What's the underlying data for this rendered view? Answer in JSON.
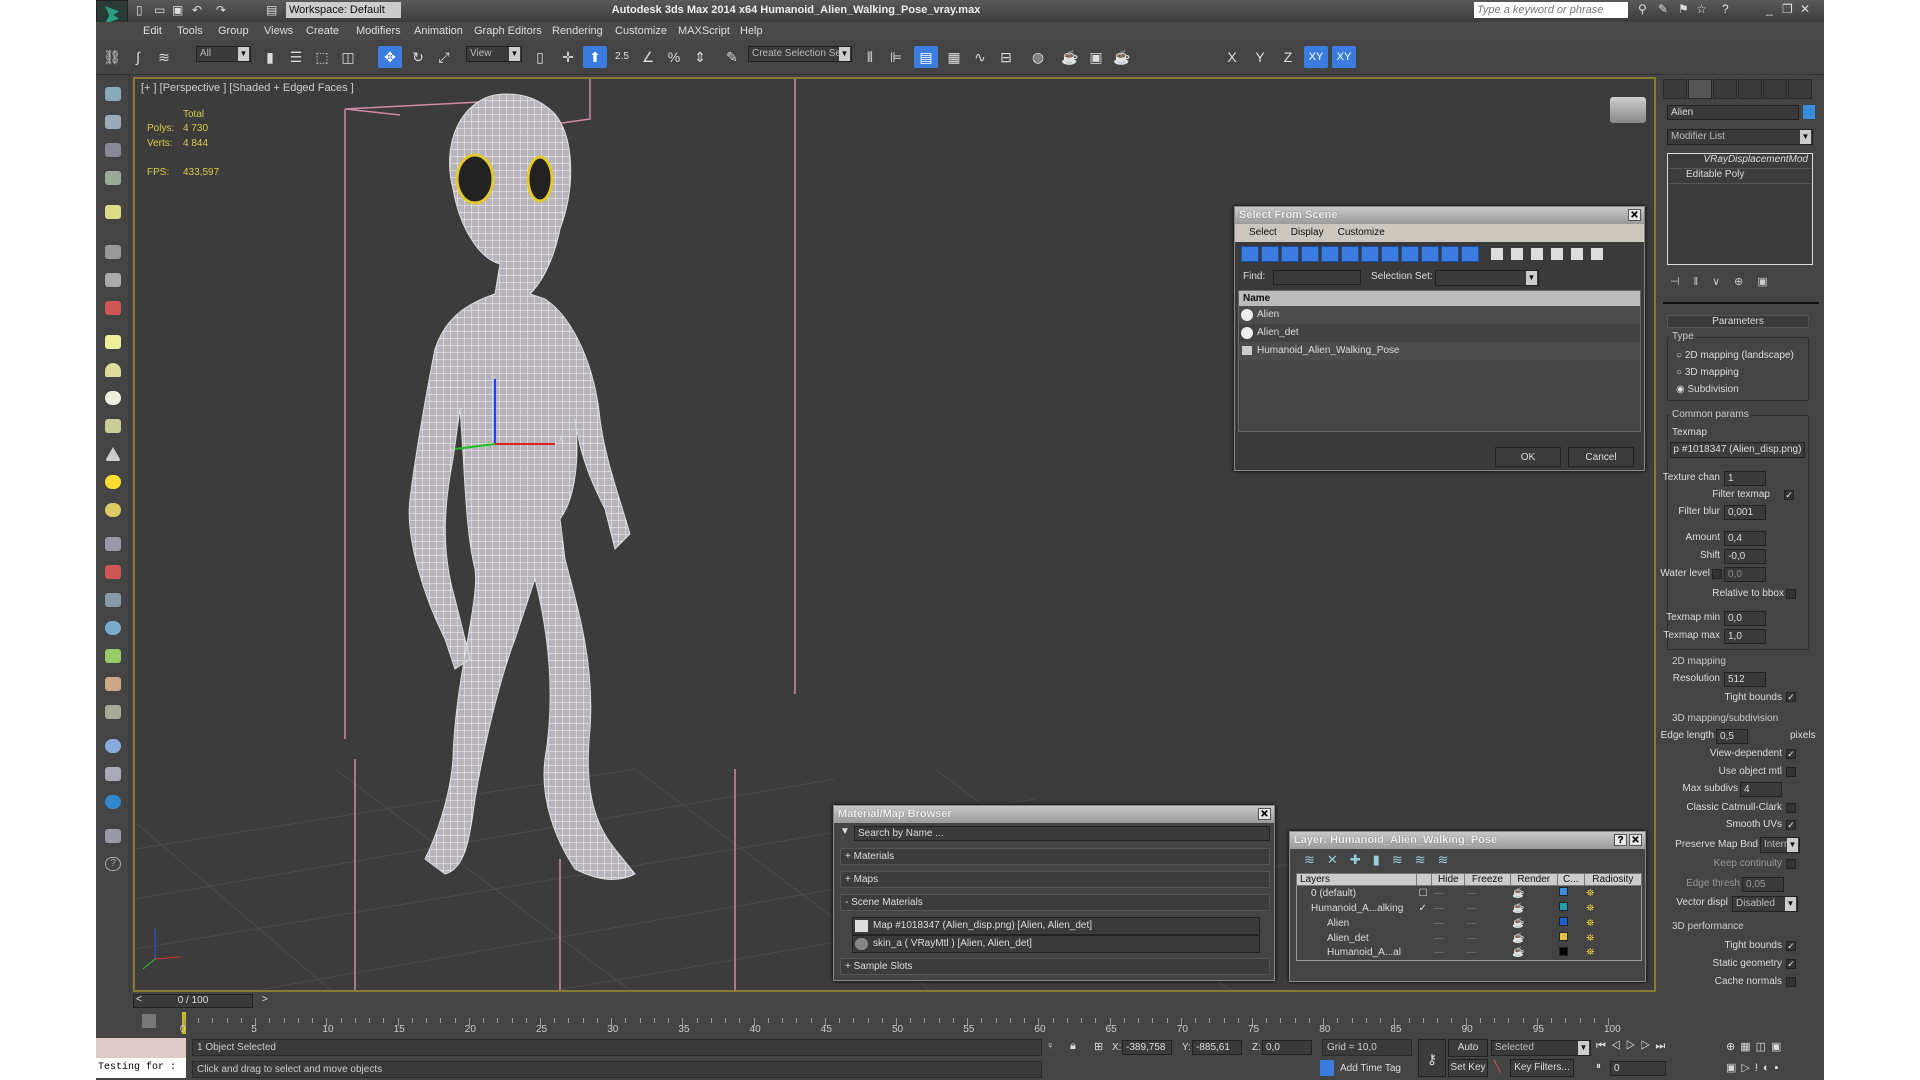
{
  "app": {
    "title": "Autodesk 3ds Max  2014 x64     Humanoid_Alien_Walking_Pose_vray.max",
    "workspace": "Workspace: Default",
    "search_placeholder": "Type a keyword or phrase"
  },
  "menu": [
    "Edit",
    "Tools",
    "Group",
    "Views",
    "Create",
    "Modifiers",
    "Animation",
    "Graph Editors",
    "Rendering",
    "Customize",
    "MAXScript",
    "Help"
  ],
  "toolbar": {
    "filter": "All",
    "ref_coord": "View",
    "snap_label": "2.5",
    "selection_set": "Create Selection Se",
    "axes": [
      "X",
      "Y",
      "Z",
      "XY",
      "XY"
    ]
  },
  "viewport": {
    "label": "[+ ] [Perspective ] [Shaded + Edged Faces ]",
    "stats": {
      "total": "Total",
      "polys_label": "Polys:",
      "polys": "4 730",
      "verts_label": "Verts:",
      "verts": "4 844",
      "fps_label": "FPS:",
      "fps": "433,597"
    },
    "axis_x": "x"
  },
  "command_panel": {
    "object_name": "Alien",
    "object_color": "#3a8ce0",
    "modifier_list": "Modifier List",
    "stack": [
      "VRayDisplacementMod",
      "Editable Poly"
    ],
    "rollout": "Parameters",
    "type_group": "Type",
    "types": [
      {
        "label": "2D mapping (landscape)",
        "selected": false
      },
      {
        "label": "3D mapping",
        "selected": false
      },
      {
        "label": "Subdivision",
        "selected": true
      }
    ],
    "common": "Common params",
    "texmap_label": "Texmap",
    "texmap": "p #1018347 (Alien_disp.png)",
    "texture_chan_label": "Texture chan",
    "texture_chan": "1",
    "filter_texmap": "Filter texmap",
    "filter_blur_label": "Filter blur",
    "filter_blur": "0,001",
    "amount_label": "Amount",
    "amount": "0,4",
    "shift_label": "Shift",
    "shift": "-0,0",
    "water_label": "Water level",
    "water": "0,0",
    "relative": "Relative to bbox",
    "tmin_label": "Texmap min",
    "tmin": "0,0",
    "tmax_label": "Texmap max",
    "tmax": "1,0",
    "map2d": "2D mapping",
    "res_label": "Resolution",
    "res": "512",
    "tight": "Tight bounds",
    "map3d": "3D mapping/subdivision",
    "edge_label": "Edge length",
    "edge": "0,5",
    "pixels": "pixels",
    "view_dep": "View-dependent",
    "use_obj": "Use object mtl",
    "max_sub_label": "Max subdivs",
    "max_sub": "4",
    "catmull": "Classic Catmull-Clark",
    "smooth_uv": "Smooth UVs",
    "preserve_label": "Preserve Map Bnd",
    "preserve": "Interr",
    "keep": "Keep continuity",
    "edge_thresh_label": "Edge thresh",
    "edge_thresh": "0,05",
    "vector_label": "Vector displ",
    "vector": "Disabled",
    "perf": "3D performance",
    "perf_tight": "Tight bounds",
    "static": "Static geometry",
    "cache": "Cache normals"
  },
  "select_dialog": {
    "title": "Select From Scene",
    "menus": [
      "Select",
      "Display",
      "Customize"
    ],
    "find_label": "Find:",
    "selset_label": "Selection Set:",
    "col_name": "Name",
    "items": [
      "Alien",
      "Alien_det",
      "Humanoid_Alien_Walking_Pose"
    ],
    "ok": "OK",
    "cancel": "Cancel"
  },
  "material_browser": {
    "title": "Material/Map Browser",
    "search_placeholder": "Search by Name ...",
    "sections": [
      "+ Materials",
      "+ Maps",
      "- Scene Materials"
    ],
    "items": [
      "Map #1018347 (Alien_disp.png)  [Alien, Alien_det]",
      "skin_a  ( VRayMtl ) [Alien, Alien_det]"
    ],
    "last": "+ Sample Slots"
  },
  "layer_dialog": {
    "title": "Layer: Humanoid_Alien_Walking_Pose",
    "help": "?",
    "columns": [
      "Layers",
      "",
      "Hide",
      "Freeze",
      "Render",
      "C...",
      "Radiosity"
    ],
    "rows": [
      {
        "name": "0 (default)",
        "mark": "☐",
        "color": "#3a8ce0"
      },
      {
        "name": "Humanoid_A...alking",
        "mark": "✓",
        "color": "#20a0b0"
      },
      {
        "name": "Alien",
        "mark": "",
        "color": "#1e5ed0"
      },
      {
        "name": "Alien_det",
        "mark": "",
        "color": "#e0c040"
      },
      {
        "name": "Humanoid_A...al",
        "mark": "",
        "color": "#000000"
      }
    ]
  },
  "timeline": {
    "frame": "0 / 100",
    "ticks": [
      "0",
      "5",
      "10",
      "15",
      "20",
      "25",
      "30",
      "35",
      "40",
      "45",
      "50",
      "55",
      "60",
      "65",
      "70",
      "75",
      "80",
      "85",
      "90",
      "95",
      "100"
    ]
  },
  "status": {
    "selected": "1 Object Selected",
    "prompt": "Click and drag to select and move objects",
    "script": "Testing for :",
    "x_label": "X:",
    "x": "-389,758",
    "y_label": "Y:",
    "y": "-885,61",
    "z_label": "Z:",
    "z": "0,0",
    "grid": "Grid = 10,0",
    "add_time_tag": "Add Time Tag",
    "auto_key": "Auto Key",
    "set_key": "Set Key",
    "key_mode": "Selected",
    "key_filters": "Key Filters...",
    "frame": "0"
  }
}
